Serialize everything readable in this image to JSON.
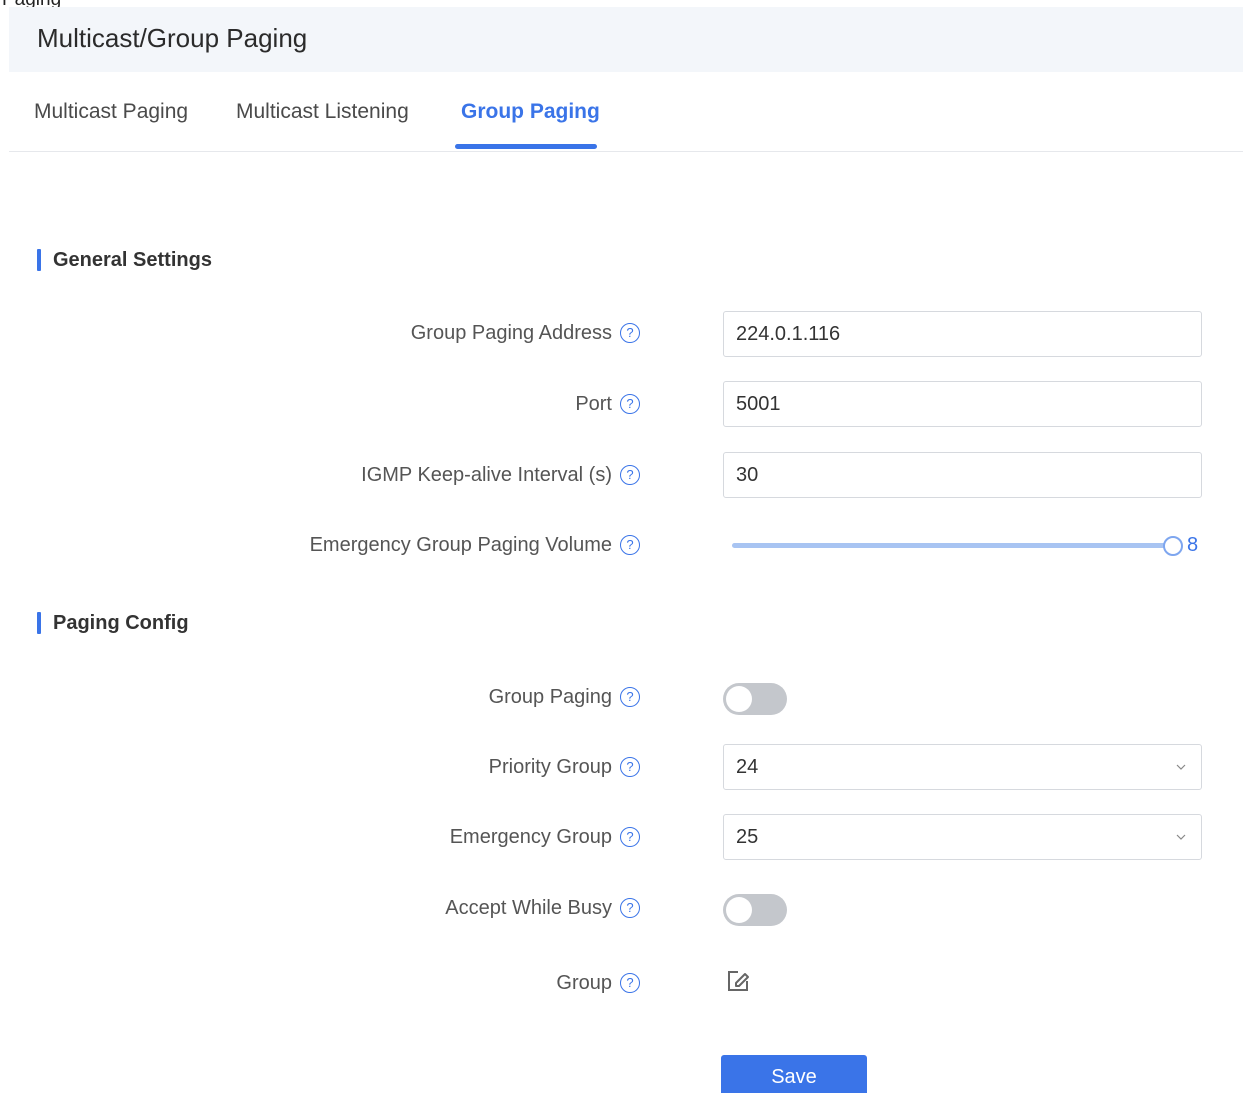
{
  "top_fragment": "Paging",
  "header": {
    "title": "Multicast/Group Paging"
  },
  "tabs": [
    {
      "label": "Multicast Paging",
      "active": false
    },
    {
      "label": "Multicast Listening",
      "active": false
    },
    {
      "label": "Group Paging",
      "active": true
    }
  ],
  "general_settings": {
    "title": "General Settings",
    "group_paging_address": {
      "label": "Group Paging Address",
      "value": "224.0.1.116"
    },
    "port": {
      "label": "Port",
      "value": "5001"
    },
    "igmp_keepalive": {
      "label": "IGMP Keep-alive Interval (s)",
      "value": "30"
    },
    "emergency_volume": {
      "label": "Emergency Group Paging Volume",
      "value": "8",
      "fraction": 1.0
    }
  },
  "paging_config": {
    "title": "Paging Config",
    "group_paging": {
      "label": "Group Paging",
      "enabled": false
    },
    "priority_group": {
      "label": "Priority Group",
      "value": "24"
    },
    "emergency_group": {
      "label": "Emergency Group",
      "value": "25"
    },
    "accept_while_busy": {
      "label": "Accept While Busy",
      "enabled": false
    },
    "group": {
      "label": "Group"
    }
  },
  "actions": {
    "save_label": "Save"
  },
  "colors": {
    "accent": "#3a74e8",
    "header_bg": "#f3f6fa",
    "toggle_off": "#c4c7cc",
    "slider_track": "#a8c4f2"
  },
  "icons": {
    "help": "question-circle-icon",
    "chevron": "chevron-down-icon",
    "edit": "edit-icon"
  }
}
